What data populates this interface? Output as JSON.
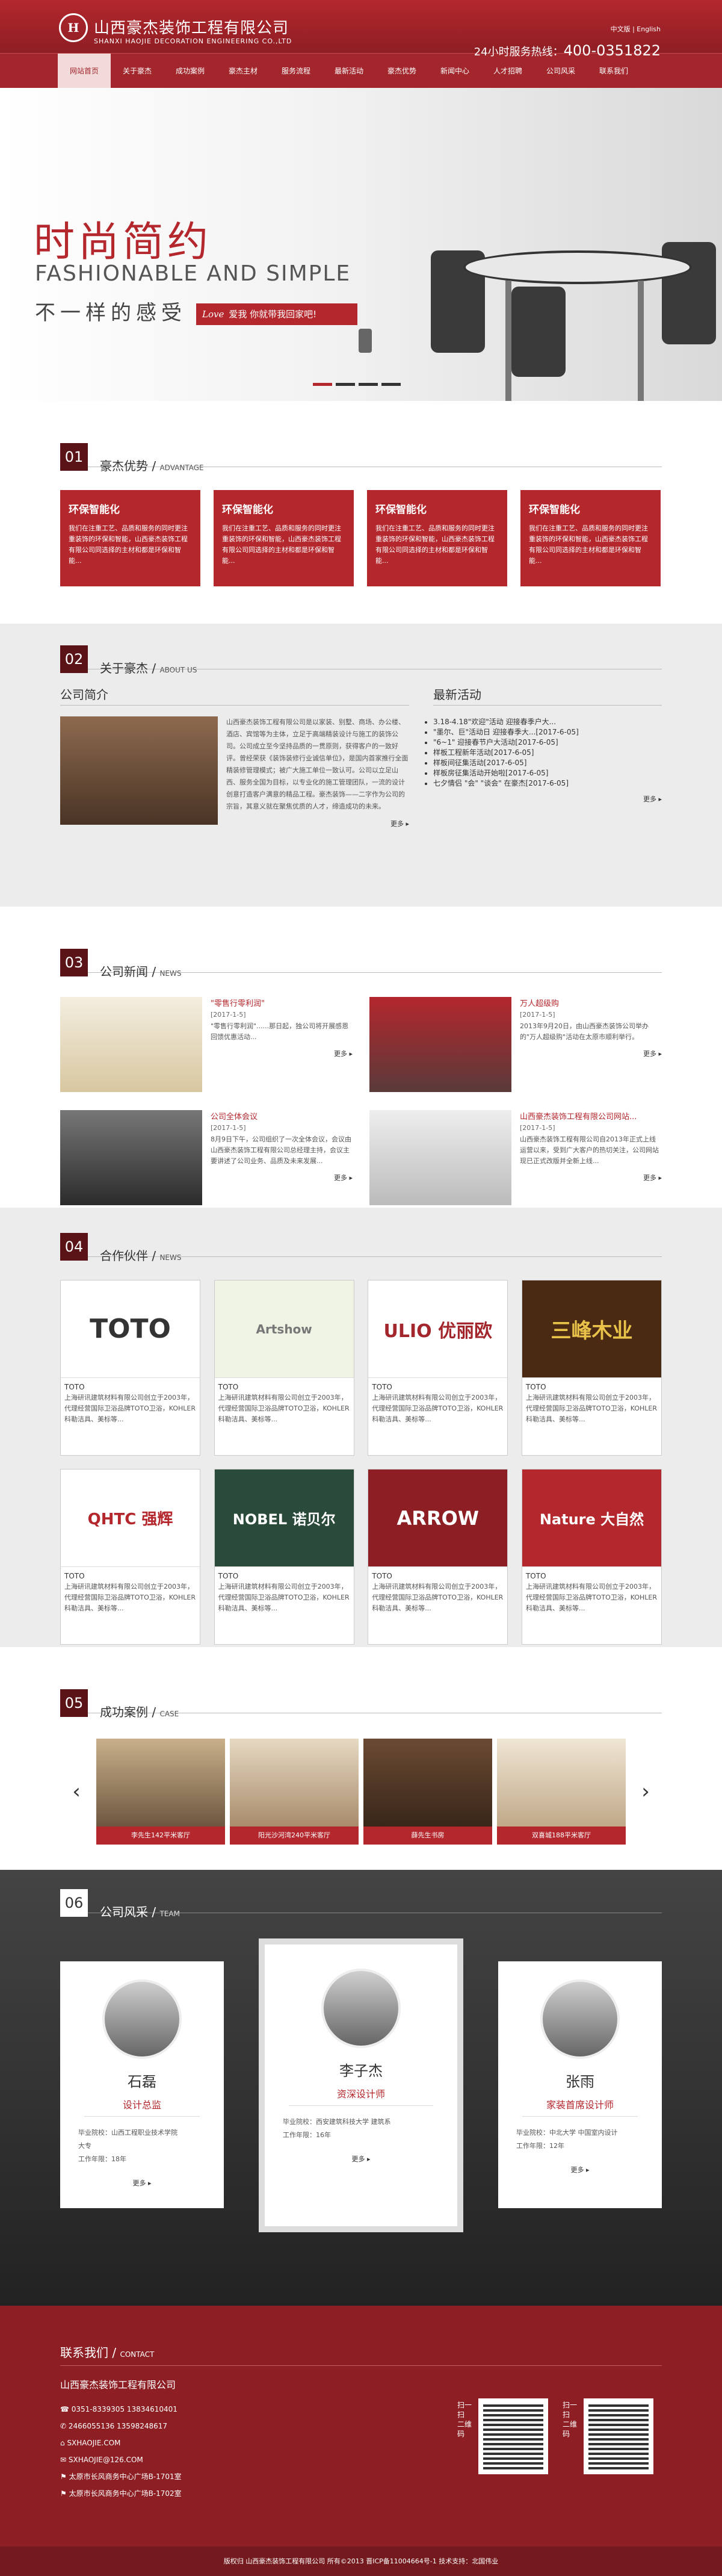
{
  "header": {
    "logo_mark": "H",
    "company_cn": "山西豪杰装饰工程有限公司",
    "company_en": "SHANXI HAOJIE DECORATION ENGINEERING CO.,LTD",
    "lang": "中文版 | English",
    "hotline_label": "24小时服务热线：",
    "hotline": "400-0351822"
  },
  "nav": [
    "网站首页",
    "关于豪杰",
    "成功案例",
    "豪杰主材",
    "服务流程",
    "最新活动",
    "豪杰优势",
    "新闻中心",
    "人才招聘",
    "公司风采",
    "联系我们"
  ],
  "banner": {
    "title": "时尚简约",
    "en": "FASHIONABLE AND SIMPLE",
    "sub": "不一样的感受",
    "tag_love": "Love",
    "tag": "爱我 你就带我回家吧!"
  },
  "advantage": {
    "num": "01",
    "title": "豪杰优势",
    "en": "ADVANTAGE",
    "cards": [
      {
        "t": "环保智能化",
        "d": "我们在注重工艺、品质和服务的同时更注重装饰的环保和智能，山西豪杰装饰工程有限公司同选择的主材和都是环保和智能..."
      },
      {
        "t": "环保智能化",
        "d": "我们在注重工艺、品质和服务的同时更注重装饰的环保和智能，山西豪杰装饰工程有限公司同选择的主材和都是环保和智能..."
      },
      {
        "t": "环保智能化",
        "d": "我们在注重工艺、品质和服务的同时更注重装饰的环保和智能，山西豪杰装饰工程有限公司同选择的主材和都是环保和智能..."
      },
      {
        "t": "环保智能化",
        "d": "我们在注重工艺、品质和服务的同时更注重装饰的环保和智能，山西豪杰装饰工程有限公司同选择的主材和都是环保和智能..."
      }
    ]
  },
  "about": {
    "num": "02",
    "title": "关于豪杰",
    "en": "ABOUT US",
    "intro_h": "公司简介",
    "intro": "山西豪杰装饰工程有限公司是以家装、别墅、商场、办公楼、酒店、宾馆等为主体，立足于高端精装设计与施工的装饰公司。公司成立至今坚持品质的一贯原则，获得客户的一致好评。曾经荣获《装饰装修行业诚信单位》，是国内首家推行全面精装修管理模式；被广大施工单位一致认可。公司以立足山西、服务全国为目标，以专业化的施工管理团队，一流的设计创意打造客户满意的精品工程。豪杰装饰——二字作为公司的宗旨，其意义就在聚焦优质的人才，缔造成功的未来。",
    "more": "更多 ▸",
    "act_h": "最新活动",
    "acts": [
      [
        "3.18-4.18\"欢迎\"活动 迎接春季户大...",
        ""
      ],
      [
        "\"墨尔、巨\"活动日 迎接春季大...",
        "[2017-6-05]"
      ],
      [
        "\"6~1\" 迎接春节户大活动",
        "[2017-6-05]"
      ],
      [
        "样板工程新年活动",
        "[2017-6-05]"
      ],
      [
        "样板间征集活动",
        "[2017-6-05]"
      ],
      [
        "样板房征集活动开始啦",
        "[2017-6-05]"
      ],
      [
        "七夕情侣 \"会\" \"谈会\" 在豪杰",
        "[2017-6-05]"
      ]
    ]
  },
  "news": {
    "num": "03",
    "title": "公司新闻",
    "en": "NEWS",
    "items": [
      {
        "t": "\"零售行零利润\"",
        "d": "[2017-1-5]",
        "s": "\"零售行零利润\"......那日起，独公司将开展感恩回馈优惠活动...",
        "more": "更多 ▸"
      },
      {
        "t": "万人超级购",
        "d": "[2017-1-5]",
        "s": "2013年9月20日，由山西豪杰装饰公司举办的\"万人超级购\"活动在太原市顺利举行。",
        "more": "更多 ▸"
      },
      {
        "t": "公司全体会议",
        "d": "[2017-1-5]",
        "s": "8月9日下午，公司组织了一次全体会议，会议由山西豪杰装饰工程有限公司总经理主持，会议主要讲述了公司业务、品质及未来发展...",
        "more": "更多 ▸"
      },
      {
        "t": "山西豪杰装饰工程有限公司网站...",
        "d": "[2017-1-5]",
        "s": "山西豪杰装饰工程有限公司自2013年正式上线运营以来，受到广大客户的热切关注，公司网站现已正式改版并全新上线...",
        "more": "更多 ▸"
      }
    ]
  },
  "partners": {
    "num": "04",
    "title": "合作伙伴",
    "en": "NEWS",
    "items": [
      {
        "logo": "TOTO",
        "name": "TOTO",
        "d": "上海研讯建筑材料有限公司创立于2003年，代理经营国际卫浴品牌TOTO卫浴，KOHLER科勒洁具、美标等..."
      },
      {
        "logo": "Artshow",
        "name": "TOTO",
        "d": "上海研讯建筑材料有限公司创立于2003年，代理经营国际卫浴品牌TOTO卫浴，KOHLER科勒洁具、美标等..."
      },
      {
        "logo": "ULIO 优丽欧",
        "name": "TOTO",
        "d": "上海研讯建筑材料有限公司创立于2003年，代理经营国际卫浴品牌TOTO卫浴，KOHLER科勒洁具、美标等..."
      },
      {
        "logo": "三峰木业",
        "name": "TOTO",
        "d": "上海研讯建筑材料有限公司创立于2003年，代理经营国际卫浴品牌TOTO卫浴，KOHLER科勒洁具、美标等..."
      },
      {
        "logo": "QHTC 强辉",
        "name": "TOTO",
        "d": "上海研讯建筑材料有限公司创立于2003年，代理经营国际卫浴品牌TOTO卫浴，KOHLER科勒洁具、美标等..."
      },
      {
        "logo": "NOBEL 诺贝尔",
        "name": "TOTO",
        "d": "上海研讯建筑材料有限公司创立于2003年，代理经营国际卫浴品牌TOTO卫浴，KOHLER科勒洁具、美标等..."
      },
      {
        "logo": "ARROW",
        "name": "TOTO",
        "d": "上海研讯建筑材料有限公司创立于2003年，代理经营国际卫浴品牌TOTO卫浴，KOHLER科勒洁具、美标等..."
      },
      {
        "logo": "Nature 大自然",
        "name": "TOTO",
        "d": "上海研讯建筑材料有限公司创立于2003年，代理经营国际卫浴品牌TOTO卫浴，KOHLER科勒洁具、美标等..."
      }
    ]
  },
  "cases": {
    "num": "05",
    "title": "成功案例",
    "en": "CASE",
    "left": "‹",
    "right": "›",
    "items": [
      "李先生142平米客厅",
      "阳光沙河湾240平米客厅",
      "薛先生书房",
      "双喜城188平米客厅"
    ]
  },
  "team": {
    "num": "06",
    "title": "公司风采",
    "en": "TEAM",
    "members": [
      {
        "name": "石磊",
        "role": "设计总监",
        "school": "毕业院校：山西工程职业技术学院",
        "major": "大专",
        "years": "工作年限：18年",
        "more": "更多 ▸"
      },
      {
        "name": "李子杰",
        "role": "资深设计师",
        "school": "毕业院校：西安建筑科技大学 建筑系",
        "major": "",
        "years": "工作年限：16年",
        "more": "更多 ▸"
      },
      {
        "name": "张雨",
        "role": "家装首席设计师",
        "school": "毕业院校：中北大学  中国室内设计",
        "major": "",
        "years": "工作年限：12年",
        "more": "更多 ▸"
      }
    ]
  },
  "footer": {
    "title": "联系我们",
    "en": "CONTACT",
    "company": "山西豪杰装饰工程有限公司",
    "lines": [
      "0351-8339305  13834610401",
      "2466055136  13598248617",
      "SXHAOJIE.COM",
      "SXHAOJIE@126.COM",
      "太原市长风商务中心广场B-1701室",
      "太原市长风商务中心广场B-1702室"
    ],
    "qr1": "扫一扫 二维码",
    "qr2": "扫一扫 二维码",
    "copyright": "版权归 山西豪杰装饰工程有限公司 所有©2013 晋ICP备11004664号-1 技术支持：北国伟业"
  }
}
